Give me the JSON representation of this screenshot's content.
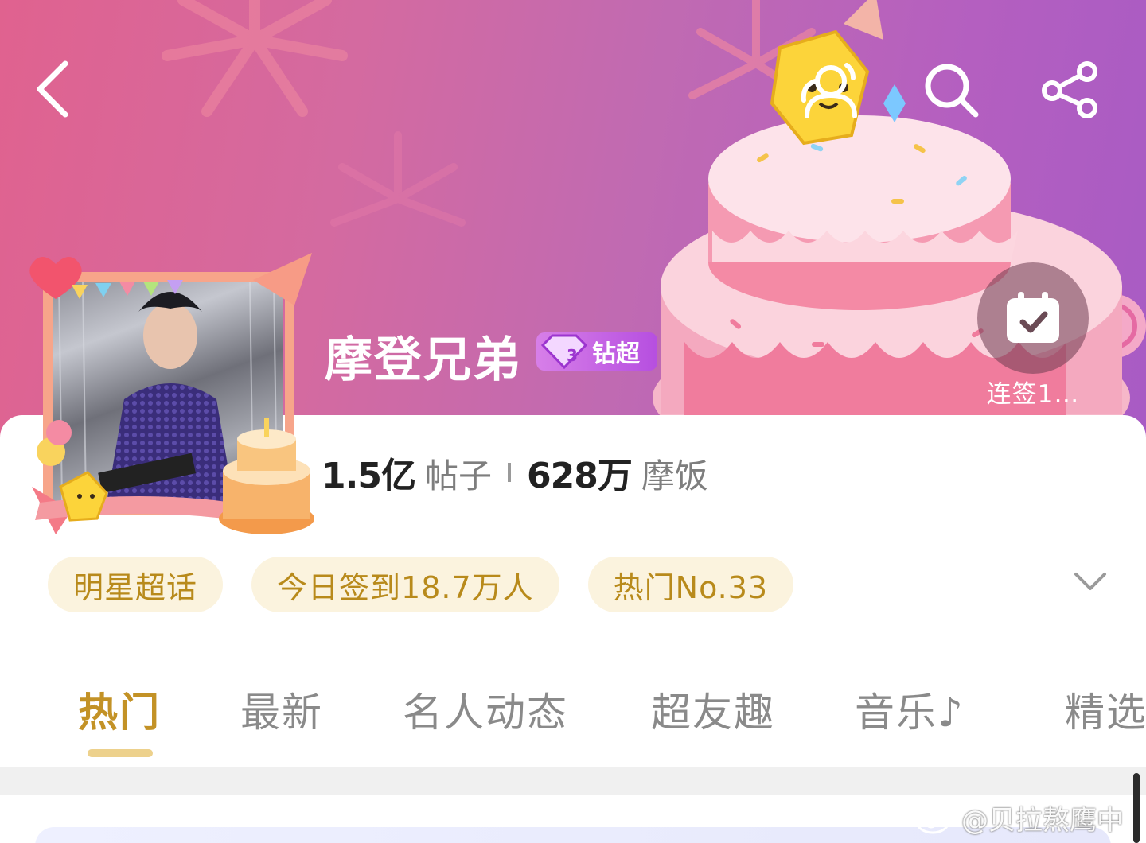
{
  "header": {
    "title": "摩登兄弟",
    "badge_label": "钻超",
    "badge_level": "3",
    "checkin_label": "连签1…"
  },
  "stats": {
    "posts_count": "1.5亿",
    "posts_label": "帖子",
    "fans_count": "628万",
    "fans_label": "摩饭"
  },
  "tags": [
    {
      "label": "明星超话"
    },
    {
      "label": "今日签到18.7万人"
    },
    {
      "label": "热门No.33"
    }
  ],
  "tabs": [
    {
      "label": "热门",
      "active": true
    },
    {
      "label": "最新",
      "active": false
    },
    {
      "label": "名人动态",
      "active": false
    },
    {
      "label": "超友趣",
      "active": false
    },
    {
      "label": "音乐♪",
      "active": false
    },
    {
      "label": "精选",
      "active": false
    }
  ],
  "watermark": {
    "text": "@贝拉熬鹰中"
  },
  "icons": {
    "back": "back-arrow-icon",
    "members": "members-icon",
    "search": "search-icon",
    "share": "share-icon",
    "checkin": "calendar-check-icon",
    "expand": "chevron-down-icon"
  },
  "colors": {
    "accent": "#c39226",
    "tag_bg": "#fbf3de",
    "tag_text": "#b88a1b",
    "badge": "#b64fe0"
  }
}
